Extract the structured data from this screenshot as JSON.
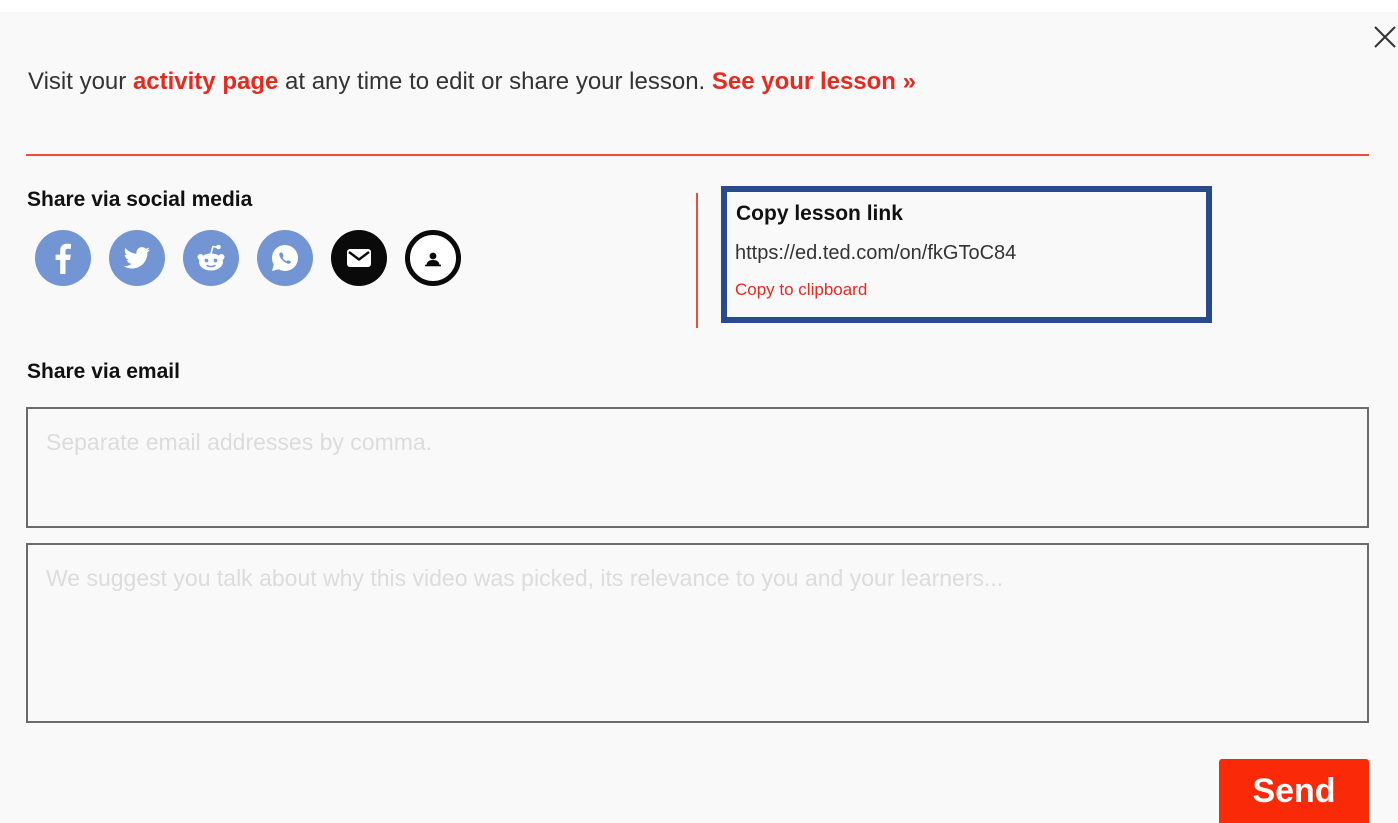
{
  "intro": {
    "prefix": "Visit your ",
    "activity_link": "activity page",
    "middle": " at any time to edit or share your lesson. ",
    "see_lesson_link": "See your lesson »"
  },
  "social": {
    "title": "Share via social media",
    "buttons": [
      {
        "name": "facebook",
        "icon": "facebook-icon"
      },
      {
        "name": "twitter",
        "icon": "twitter-icon"
      },
      {
        "name": "reddit",
        "icon": "reddit-icon"
      },
      {
        "name": "whatsapp",
        "icon": "whatsapp-icon"
      },
      {
        "name": "email",
        "icon": "envelope-icon"
      },
      {
        "name": "classroom",
        "icon": "person-icon"
      }
    ]
  },
  "copy_link": {
    "title": "Copy lesson link",
    "url": "https://ed.ted.com/on/fkGToC84",
    "action": "Copy to clipboard"
  },
  "email": {
    "title": "Share via email",
    "addresses_placeholder": "Separate email addresses by comma.",
    "addresses_value": "",
    "message_placeholder": "We suggest you talk about why this video was picked, its relevance to you and your learners...",
    "message_value": "",
    "send_label": "Send"
  },
  "colors": {
    "accent": "#e62b1e",
    "send": "#fa2a08",
    "social_blue": "#7395d4",
    "highlight_border": "#274b8c"
  }
}
